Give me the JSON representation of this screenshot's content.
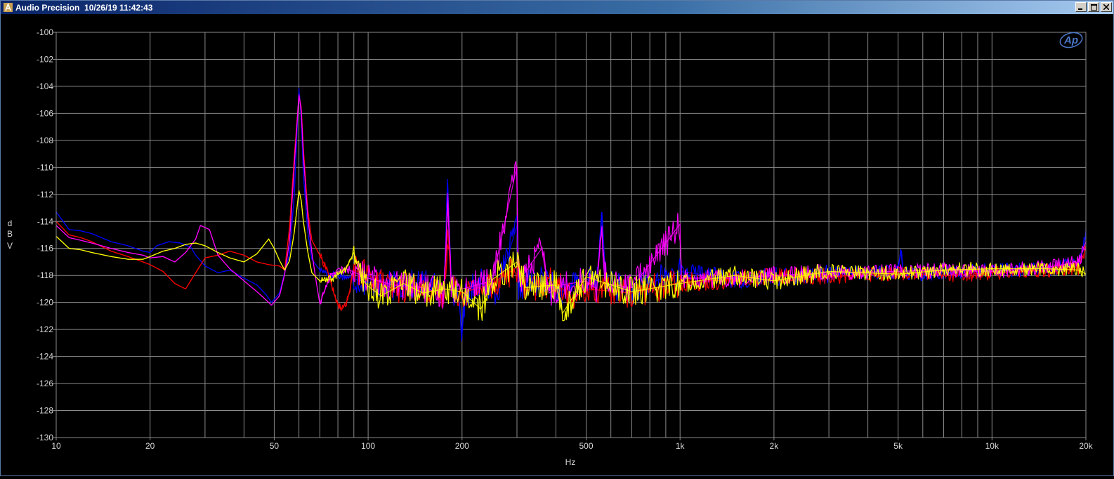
{
  "window": {
    "title": "Audio Precision  10/26/19 11:42:43",
    "icon": "audio-precision-app-icon",
    "controls": [
      "minimize-icon",
      "maximize-icon",
      "close-icon"
    ]
  },
  "colors": {
    "background": "#000000",
    "grid": "#8a8a8a",
    "text": "#d8d8d8",
    "logo": "#4a78c8",
    "series": [
      "#0000ff",
      "#ff0000",
      "#ff00ff",
      "#ffff00"
    ]
  },
  "logo_text": "Ap",
  "chart_data": {
    "type": "line",
    "title": "",
    "xlabel": "Hz",
    "ylabel": "dBV",
    "ylabel_chars": [
      "d",
      "B",
      "V"
    ],
    "xscale": "log",
    "xlim": [
      10,
      20000
    ],
    "ylim": [
      -130,
      -100
    ],
    "grid": true,
    "legend": "none",
    "yticks": [
      -100,
      -102,
      -104,
      -106,
      -108,
      -110,
      -112,
      -114,
      -116,
      -118,
      -120,
      -122,
      -124,
      -126,
      -128,
      -130
    ],
    "xtick_labels": [
      {
        "value": 10,
        "label": "10"
      },
      {
        "value": 20,
        "label": "20"
      },
      {
        "value": 50,
        "label": "50"
      },
      {
        "value": 100,
        "label": "100"
      },
      {
        "value": 200,
        "label": "200"
      },
      {
        "value": 500,
        "label": "500"
      },
      {
        "value": 1000,
        "label": "1k"
      },
      {
        "value": 2000,
        "label": "2k"
      },
      {
        "value": 5000,
        "label": "5k"
      },
      {
        "value": 10000,
        "label": "10k"
      },
      {
        "value": 20000,
        "label": "20k"
      }
    ],
    "series": [
      {
        "color": "#0000ff",
        "points": [
          [
            10,
            -113.3
          ],
          [
            11,
            -114.6
          ],
          [
            12,
            -114.7
          ],
          [
            13,
            -114.9
          ],
          [
            15,
            -115.5
          ],
          [
            17,
            -115.8
          ],
          [
            19,
            -116.2
          ],
          [
            20,
            -116.3
          ],
          [
            21,
            -115.8
          ],
          [
            23,
            -115.5
          ],
          [
            25,
            -115.6
          ],
          [
            27,
            -115.9
          ],
          [
            28,
            -116.5
          ],
          [
            30,
            -117.3
          ],
          [
            33,
            -117.8
          ],
          [
            36,
            -117.6
          ],
          [
            40,
            -118.2
          ],
          [
            44,
            -118.7
          ],
          [
            47,
            -119.4
          ],
          [
            49,
            -120.0
          ],
          [
            52,
            -119.3
          ],
          [
            54,
            -117.8
          ],
          [
            56,
            -116.4
          ],
          [
            58,
            -112.0
          ],
          [
            60,
            -104.1
          ],
          [
            61,
            -106.2
          ],
          [
            62,
            -110.5
          ],
          [
            64,
            -114.7
          ],
          [
            66,
            -116.8
          ],
          [
            70,
            -117.6
          ],
          [
            76,
            -117.9
          ],
          [
            85,
            -118.1
          ],
          [
            100,
            -118.5
          ],
          [
            120,
            -118.8
          ],
          [
            150,
            -118.6
          ],
          [
            175,
            -119.0
          ],
          [
            180,
            -111.2
          ],
          [
            185,
            -118.9
          ],
          [
            195,
            -119.6
          ],
          [
            200,
            -122.2
          ],
          [
            205,
            -119.5
          ],
          [
            220,
            -118.4
          ],
          [
            260,
            -119.1
          ],
          [
            300,
            -114.3
          ],
          [
            303,
            -118.8
          ],
          [
            360,
            -118.4
          ],
          [
            420,
            -119.2
          ],
          [
            500,
            -118.2
          ],
          [
            540,
            -119.0
          ],
          [
            560,
            -113.3
          ],
          [
            580,
            -118.6
          ],
          [
            700,
            -119.1
          ],
          [
            1000,
            -117.7
          ],
          [
            1500,
            -118.3
          ],
          [
            2000,
            -118.1
          ],
          [
            3000,
            -117.9
          ],
          [
            5000,
            -117.7
          ],
          [
            5100,
            -116.2
          ],
          [
            5200,
            -117.9
          ],
          [
            7000,
            -117.8
          ],
          [
            10000,
            -117.6
          ],
          [
            15000,
            -117.5
          ],
          [
            19000,
            -117.2
          ],
          [
            20000,
            -115.1
          ]
        ]
      },
      {
        "color": "#ff0000",
        "points": [
          [
            10,
            -114.0
          ],
          [
            11,
            -115.0
          ],
          [
            12,
            -115.2
          ],
          [
            13,
            -115.5
          ],
          [
            15,
            -116.2
          ],
          [
            17,
            -116.6
          ],
          [
            19,
            -117.0
          ],
          [
            20,
            -117.2
          ],
          [
            22,
            -117.7
          ],
          [
            24,
            -118.6
          ],
          [
            26,
            -119.0
          ],
          [
            28,
            -117.8
          ],
          [
            30,
            -116.7
          ],
          [
            33,
            -116.5
          ],
          [
            36,
            -116.2
          ],
          [
            40,
            -116.5
          ],
          [
            44,
            -117.0
          ],
          [
            48,
            -117.2
          ],
          [
            52,
            -117.3
          ],
          [
            54,
            -117.6
          ],
          [
            56,
            -114.4
          ],
          [
            58,
            -109.2
          ],
          [
            60,
            -104.7
          ],
          [
            61,
            -105.5
          ],
          [
            62,
            -108.6
          ],
          [
            64,
            -113.1
          ],
          [
            66,
            -115.4
          ],
          [
            70,
            -116.5
          ],
          [
            74,
            -117.6
          ],
          [
            78,
            -119.5
          ],
          [
            82,
            -120.6
          ],
          [
            86,
            -119.8
          ],
          [
            90,
            -117.6
          ],
          [
            100,
            -118.0
          ],
          [
            120,
            -119.0
          ],
          [
            150,
            -118.8
          ],
          [
            175,
            -119.6
          ],
          [
            180,
            -114.6
          ],
          [
            185,
            -119.0
          ],
          [
            200,
            -119.3
          ],
          [
            250,
            -118.6
          ],
          [
            300,
            -117.4
          ],
          [
            320,
            -119.1
          ],
          [
            400,
            -118.4
          ],
          [
            450,
            -119.8
          ],
          [
            500,
            -119.0
          ],
          [
            700,
            -119.3
          ],
          [
            1000,
            -118.5
          ],
          [
            1500,
            -118.3
          ],
          [
            2000,
            -118.0
          ],
          [
            3000,
            -118.1
          ],
          [
            5000,
            -117.8
          ],
          [
            7000,
            -118.0
          ],
          [
            10000,
            -117.8
          ],
          [
            15000,
            -117.6
          ],
          [
            19000,
            -117.4
          ],
          [
            20000,
            -116.0
          ]
        ]
      },
      {
        "color": "#ff00ff",
        "points": [
          [
            10,
            -114.3
          ],
          [
            11,
            -115.2
          ],
          [
            12,
            -115.4
          ],
          [
            13,
            -115.6
          ],
          [
            15,
            -116.0
          ],
          [
            17,
            -116.3
          ],
          [
            19,
            -116.5
          ],
          [
            20,
            -116.7
          ],
          [
            22,
            -116.6
          ],
          [
            24,
            -117.0
          ],
          [
            26,
            -116.3
          ],
          [
            28,
            -115.3
          ],
          [
            29,
            -114.3
          ],
          [
            31,
            -114.6
          ],
          [
            33,
            -116.5
          ],
          [
            36,
            -117.5
          ],
          [
            40,
            -118.4
          ],
          [
            44,
            -119.2
          ],
          [
            47,
            -119.8
          ],
          [
            49,
            -120.2
          ],
          [
            52,
            -119.5
          ],
          [
            54,
            -117.9
          ],
          [
            56,
            -115.4
          ],
          [
            58,
            -109.8
          ],
          [
            60,
            -104.6
          ],
          [
            61,
            -105.7
          ],
          [
            62,
            -109.1
          ],
          [
            64,
            -113.6
          ],
          [
            66,
            -116.3
          ],
          [
            68,
            -118.3
          ],
          [
            70,
            -120.1
          ],
          [
            72,
            -119.3
          ],
          [
            76,
            -117.9
          ],
          [
            85,
            -117.5
          ],
          [
            100,
            -118.2
          ],
          [
            120,
            -118.7
          ],
          [
            150,
            -118.9
          ],
          [
            175,
            -119.4
          ],
          [
            180,
            -111.9
          ],
          [
            185,
            -119.0
          ],
          [
            200,
            -119.0
          ],
          [
            250,
            -118.4
          ],
          [
            300,
            -109.9
          ],
          [
            303,
            -118.5
          ],
          [
            360,
            -116.0
          ],
          [
            380,
            -119.3
          ],
          [
            420,
            -118.7
          ],
          [
            500,
            -118.4
          ],
          [
            540,
            -119.0
          ],
          [
            560,
            -114.7
          ],
          [
            580,
            -118.6
          ],
          [
            700,
            -118.9
          ],
          [
            1000,
            -114.2
          ],
          [
            1010,
            -118.2
          ],
          [
            1500,
            -118.2
          ],
          [
            2000,
            -118.0
          ],
          [
            3000,
            -117.8
          ],
          [
            5000,
            -117.7
          ],
          [
            7000,
            -117.6
          ],
          [
            10000,
            -117.7
          ],
          [
            15000,
            -117.4
          ],
          [
            19000,
            -117.0
          ],
          [
            20000,
            -115.5
          ]
        ]
      },
      {
        "color": "#ffff00",
        "points": [
          [
            10,
            -115.1
          ],
          [
            11,
            -116.0
          ],
          [
            12,
            -116.1
          ],
          [
            13,
            -116.3
          ],
          [
            15,
            -116.6
          ],
          [
            17,
            -116.8
          ],
          [
            19,
            -116.8
          ],
          [
            20,
            -116.6
          ],
          [
            22,
            -116.2
          ],
          [
            24,
            -116.0
          ],
          [
            26,
            -115.7
          ],
          [
            28,
            -115.6
          ],
          [
            30,
            -115.8
          ],
          [
            33,
            -116.3
          ],
          [
            36,
            -116.7
          ],
          [
            40,
            -117.0
          ],
          [
            44,
            -116.4
          ],
          [
            48,
            -115.3
          ],
          [
            50,
            -116.0
          ],
          [
            52,
            -116.9
          ],
          [
            54,
            -117.6
          ],
          [
            56,
            -116.9
          ],
          [
            58,
            -114.8
          ],
          [
            60,
            -111.7
          ],
          [
            61,
            -112.4
          ],
          [
            62,
            -114.0
          ],
          [
            64,
            -116.2
          ],
          [
            66,
            -117.8
          ],
          [
            70,
            -118.4
          ],
          [
            76,
            -118.3
          ],
          [
            85,
            -117.5
          ],
          [
            90,
            -116.3
          ],
          [
            95,
            -118.2
          ],
          [
            100,
            -118.8
          ],
          [
            110,
            -119.5
          ],
          [
            130,
            -118.6
          ],
          [
            150,
            -119.3
          ],
          [
            175,
            -119.0
          ],
          [
            200,
            -119.2
          ],
          [
            230,
            -120.5
          ],
          [
            250,
            -118.3
          ],
          [
            300,
            -117.0
          ],
          [
            320,
            -118.9
          ],
          [
            400,
            -118.7
          ],
          [
            420,
            -120.8
          ],
          [
            500,
            -118.1
          ],
          [
            700,
            -119.2
          ],
          [
            1000,
            -118.6
          ],
          [
            1500,
            -118.0
          ],
          [
            2000,
            -118.4
          ],
          [
            3000,
            -117.7
          ],
          [
            5000,
            -117.9
          ],
          [
            7000,
            -117.6
          ],
          [
            10000,
            -117.5
          ],
          [
            15000,
            -117.5
          ],
          [
            19000,
            -117.6
          ],
          [
            20000,
            -117.9
          ]
        ]
      }
    ]
  }
}
